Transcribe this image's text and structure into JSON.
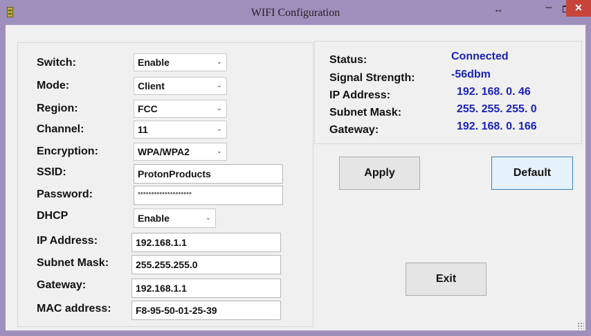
{
  "window": {
    "title": "WIFI Configuration",
    "close_glyph": "✕",
    "min_glyph": "–",
    "restore_glyph": "↔",
    "accent_color": "#9f8fbd",
    "close_color": "#c7443a"
  },
  "settings": {
    "switch": {
      "label": "Switch:",
      "value": "Enable"
    },
    "mode": {
      "label": "Mode:",
      "value": "Client"
    },
    "region": {
      "label": "Region:",
      "value": "FCC"
    },
    "channel": {
      "label": "Channel:",
      "value": "11"
    },
    "encryption": {
      "label": "Encryption:",
      "value": "WPA/WPA2"
    },
    "ssid": {
      "label": "SSID:",
      "value": "ProtonProducts"
    },
    "password": {
      "label": "Password:",
      "value": "********************"
    },
    "dhcp": {
      "label": "DHCP",
      "value": "Enable"
    },
    "ip": {
      "label": "IP Address:",
      "value": "192.168.1.1"
    },
    "subnet": {
      "label": "Subnet Mask:",
      "value": "255.255.255.0"
    },
    "gateway": {
      "label": "Gateway:",
      "value": "192.168.1.1"
    },
    "mac": {
      "label": "MAC address:",
      "value": "F8-95-50-01-25-39"
    }
  },
  "status": {
    "status": {
      "label": "Status:",
      "value": "Connected"
    },
    "signal": {
      "label": "Signal Strength:",
      "value": "-56dbm"
    },
    "ip": {
      "label": "IP Address:",
      "value": "192. 168. 0. 46"
    },
    "subnet": {
      "label": "Subnet Mask:",
      "value": "255. 255. 255. 0"
    },
    "gateway": {
      "label": "Gateway:",
      "value": "192. 168. 0. 166"
    },
    "value_color": "#1a22b8"
  },
  "buttons": {
    "apply": "Apply",
    "default": "Default",
    "exit": "Exit"
  },
  "icons": {
    "dropdown": "chevron-down-icon",
    "app": "app-icon"
  }
}
